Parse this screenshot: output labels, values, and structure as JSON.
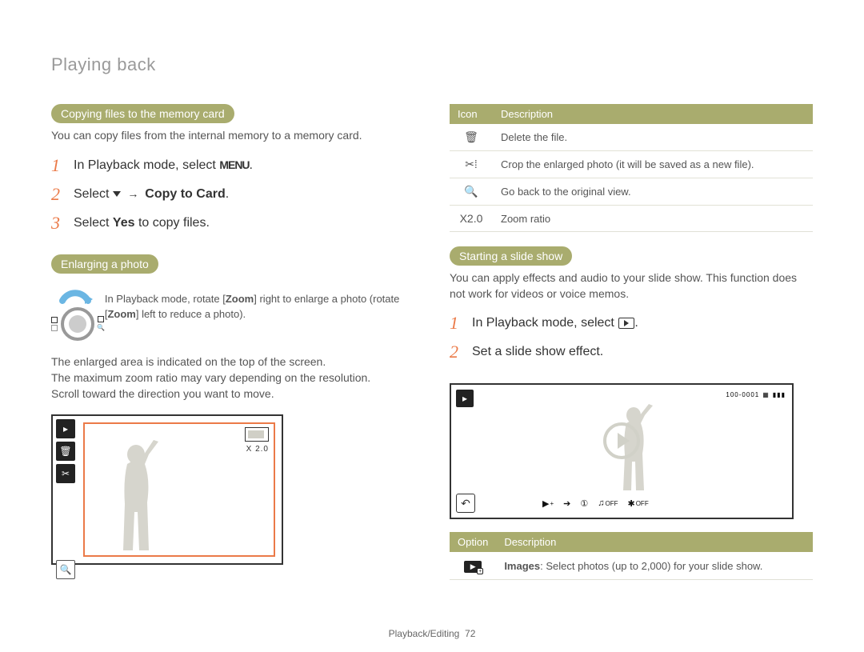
{
  "pageHeader": "Playing back",
  "footer": {
    "section": "Playback/Editing",
    "page": "72"
  },
  "left": {
    "copyCard": {
      "title": "Copying files to the memory card",
      "intro": "You can copy files from the internal memory to a memory card.",
      "steps": {
        "s1_pre": "In Playback mode, select ",
        "s1_icon": "MENU",
        "s2_pre": "Select ",
        "s2_mid": " → ",
        "s2_bold": "Copy to Card",
        "s3_pre": "Select ",
        "s3_bold": "Yes",
        "s3_post": " to copy files."
      }
    },
    "enlarge": {
      "title": "Enlarging a photo",
      "callout_a": "In Playback mode, rotate [",
      "callout_zoom": "Zoom",
      "callout_b": "] right to enlarge a photo (rotate [",
      "callout_c": "] left to reduce a photo).",
      "para": "The enlarged area is indicated on the top of the screen.\nThe maximum zoom ratio may vary depending on the resolution.\nScroll toward the direction you want to move.",
      "screenshot": {
        "zoomLabel": "X 2.0"
      }
    }
  },
  "right": {
    "iconTable": {
      "headers": {
        "icon": "Icon",
        "desc": "Description"
      },
      "rows": {
        "trash": "Delete the file.",
        "crop": "Crop the enlarged photo (it will be saved as a new file).",
        "magnify": "Go back to the original view.",
        "zoomratio_label": "X2.0",
        "zoomratio_desc": "Zoom ratio"
      }
    },
    "slide": {
      "title": "Starting a slide show",
      "intro": "You can apply effects and audio to your slide show. This function does not work for videos or voice memos.",
      "steps": {
        "s1_pre": "In Playback mode, select ",
        "s2": "Set a slide show effect."
      },
      "screenshot": {
        "counter": "100-0001"
      }
    },
    "optionTable": {
      "headers": {
        "opt": "Option",
        "desc": "Description"
      },
      "row1_bold": "Images",
      "row1_rest": ": Select photos (up to 2,000) for your slide show."
    }
  }
}
